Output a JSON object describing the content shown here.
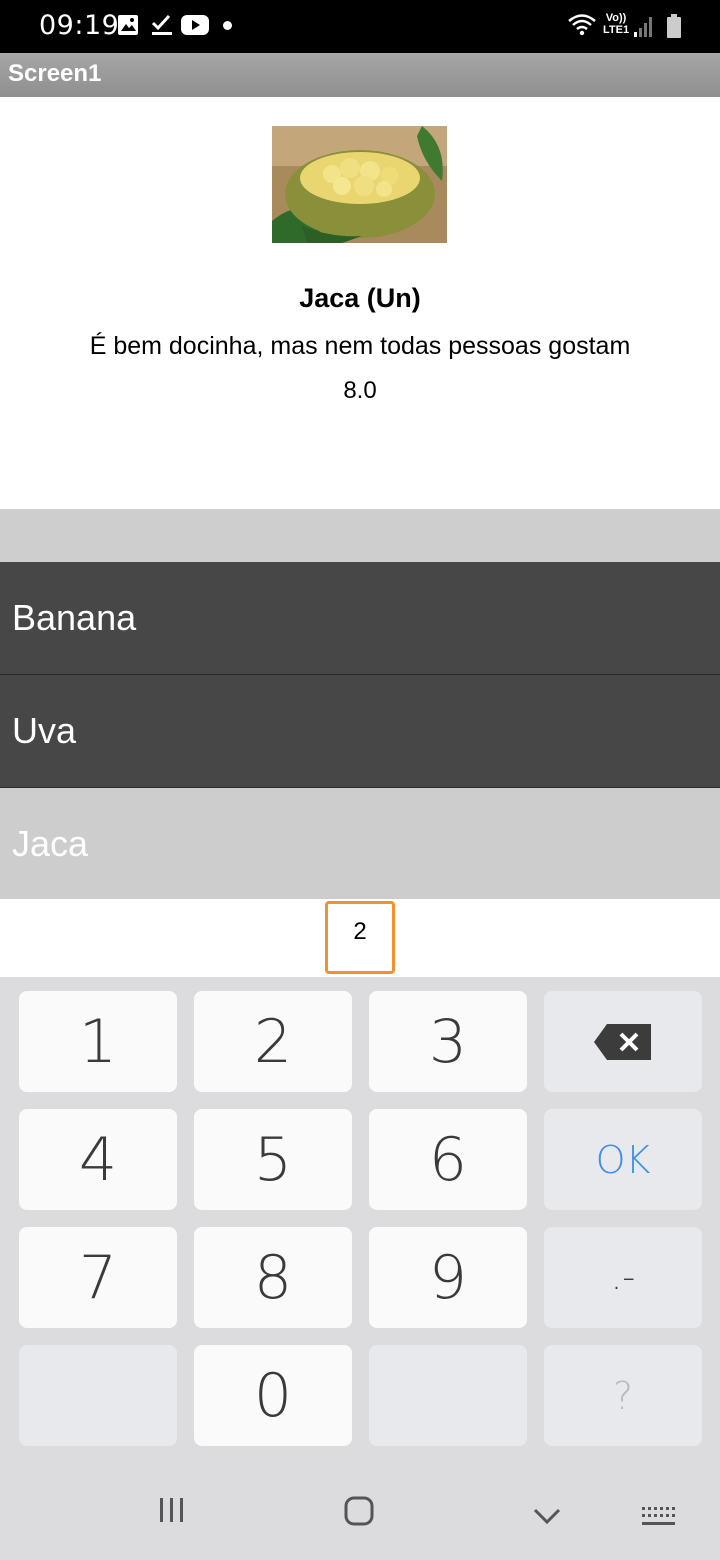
{
  "status_bar": {
    "time": "09:19",
    "icons": [
      "gallery-icon",
      "check-icon",
      "youtube-icon",
      "dot-icon",
      "wifi-icon",
      "volte-icon",
      "signal-icon",
      "battery-icon"
    ],
    "network_line1": "Vo))",
    "network_line2": "LTE1"
  },
  "title_bar": {
    "title": "Screen1"
  },
  "product": {
    "image": "jackfruit-image",
    "name": "Jaca (Un)",
    "description": "É bem docinha, mas nem todas pessoas gostam",
    "price": "8.0"
  },
  "list": {
    "items": [
      {
        "label": "Banana"
      },
      {
        "label": "Uva"
      },
      {
        "label": "Jaca"
      }
    ],
    "selected": "Jaca"
  },
  "quantity_input": {
    "value": "2",
    "border_color": "#f0922e"
  },
  "keyboard": {
    "keys": {
      "k1": "1",
      "k2": "2",
      "k3": "3",
      "k4": "4",
      "k5": "5",
      "k6": "6",
      "k7": "7",
      "k8": "8",
      "k9": "9",
      "k0": "0",
      "ok": "OK",
      "punct": ".-",
      "question": "?"
    },
    "backspace_icon": "backspace-icon",
    "ok_color": "#3d8fea"
  },
  "nav_bar": {
    "icons": [
      "recents-icon",
      "home-icon",
      "back-icon",
      "keyboard-switch-icon"
    ]
  },
  "colors": {
    "list_bg": "#474747",
    "list_selected_bg": "#cdcdcd",
    "title_bar": "#9b9b9b"
  }
}
